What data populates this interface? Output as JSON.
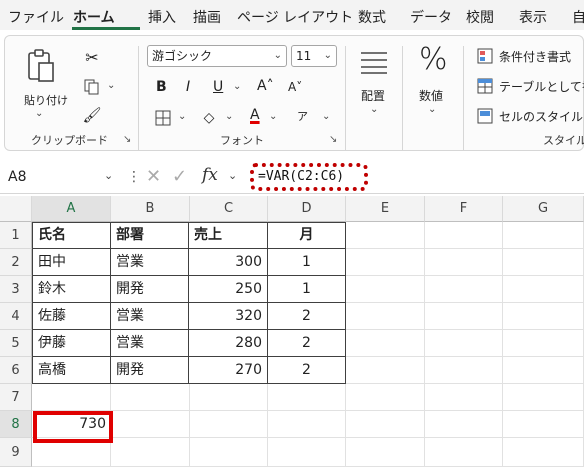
{
  "tabs": [
    "ファイル",
    "ホーム",
    "挿入",
    "描画",
    "ページ レイアウト",
    "数式",
    "データ",
    "校閲",
    "表示",
    "自"
  ],
  "active_tab": "ホーム",
  "ribbon": {
    "clipboard": {
      "paste_label": "貼り付け",
      "group_label": "クリップボード"
    },
    "font": {
      "font_name": "游ゴシック",
      "font_size": "11",
      "bold": "B",
      "italic": "I",
      "underline": "U",
      "grow": "A˄",
      "shrink": "A˅",
      "font_color": "A",
      "phonetic": "ア",
      "group_label": "フォント"
    },
    "alignment": {
      "label": "配置"
    },
    "number": {
      "label": "数値",
      "symbol": "%"
    },
    "styles": {
      "conditional": "条件付き書式",
      "table": "テーブルとして書",
      "cell_style": "セルのスタイル",
      "group_label": "スタイル"
    }
  },
  "formula_bar": {
    "name_box": "A8",
    "fx": "fx",
    "formula": "=VAR(C2:C6)"
  },
  "columns": [
    "A",
    "B",
    "C",
    "D",
    "E",
    "F",
    "G"
  ],
  "rows": [
    "1",
    "2",
    "3",
    "4",
    "5",
    "6",
    "7",
    "8",
    "9"
  ],
  "table": {
    "headers": [
      "氏名",
      "部署",
      "売上",
      "月"
    ],
    "rows": [
      [
        "田中",
        "営業",
        "300",
        "1"
      ],
      [
        "鈴木",
        "開発",
        "250",
        "1"
      ],
      [
        "佐藤",
        "営業",
        "320",
        "2"
      ],
      [
        "伊藤",
        "営業",
        "280",
        "2"
      ],
      [
        "高橋",
        "開発",
        "270",
        "2"
      ]
    ]
  },
  "result_cell": {
    "ref": "A8",
    "value": "730"
  },
  "colors": {
    "accent": "#217346",
    "highlight": "#e00000"
  }
}
